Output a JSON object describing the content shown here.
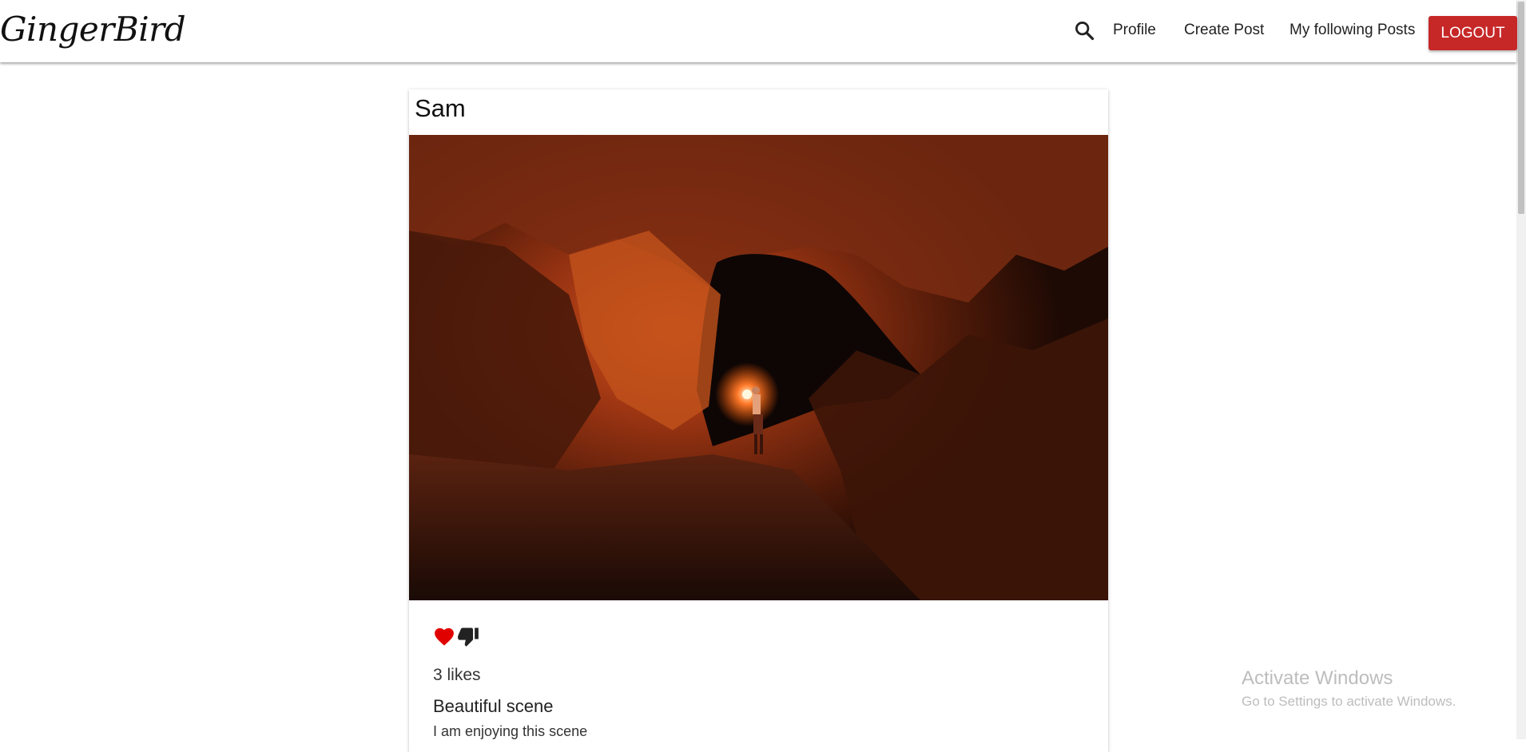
{
  "navbar": {
    "brand": "GingerBird",
    "search_icon": "search-icon",
    "links": {
      "profile": "Profile",
      "create_post": "Create Post",
      "following": "My following Posts"
    },
    "logout_label": "LOGOUT"
  },
  "post": {
    "author": "Sam",
    "image_description_icon": "photo-icon",
    "actions": {
      "like_icon": "heart-icon",
      "dislike_icon": "thumbs-down-icon"
    },
    "likes": "3 likes",
    "title": "Beautiful scene",
    "body": "I am enjoying this scene"
  },
  "watermark": {
    "title": "Activate Windows",
    "subtitle": "Go to Settings to activate Windows."
  },
  "colors": {
    "accent": "#c62828",
    "like": "#e10000",
    "text": "#222222"
  }
}
